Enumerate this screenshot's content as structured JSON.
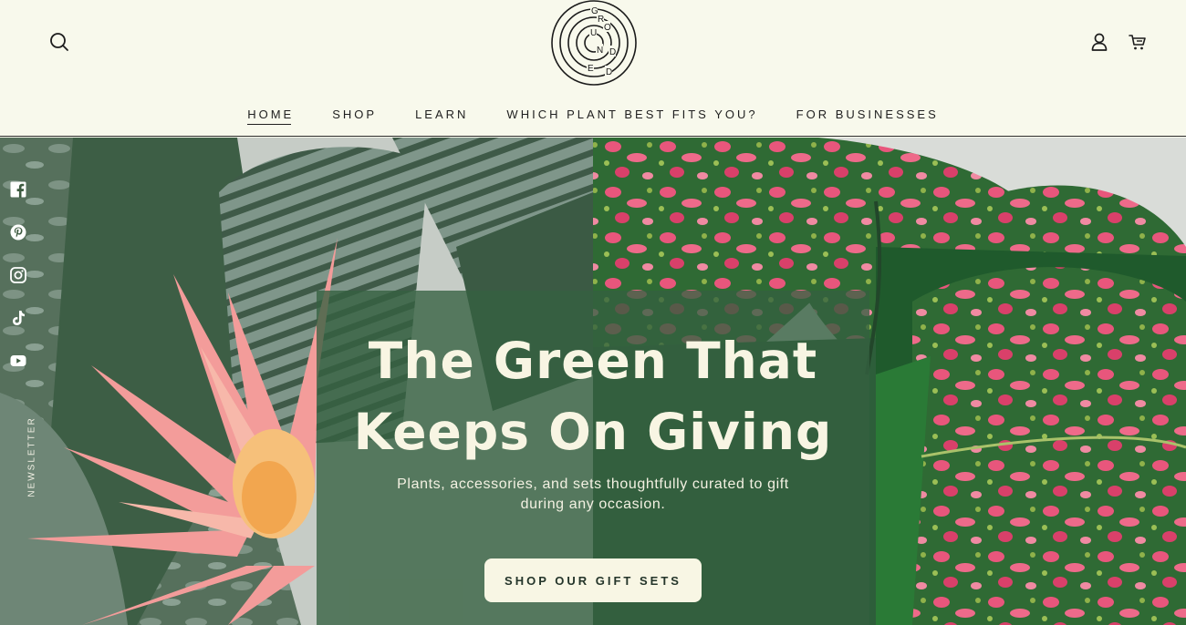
{
  "header": {
    "logo_letters": [
      "G",
      "R",
      "O",
      "U",
      "N",
      "D",
      "E",
      "D"
    ],
    "icons": {
      "search": "search-icon",
      "account": "user-icon",
      "cart": "cart-icon"
    }
  },
  "nav": {
    "items": [
      {
        "label": "HOME",
        "active": true
      },
      {
        "label": "SHOP",
        "active": false
      },
      {
        "label": "LEARN",
        "active": false
      },
      {
        "label": "WHICH PLANT BEST FITS YOU?",
        "active": false
      },
      {
        "label": "FOR BUSINESSES",
        "active": false
      }
    ]
  },
  "hero": {
    "title_line1": "The Green That",
    "title_line2": "Keeps On Giving",
    "subtitle_line1": "Plants, accessories, and sets thoughtfully curated to gift",
    "subtitle_line2": "during any occasion.",
    "cta_label": "SHOP OUR GIFT SETS"
  },
  "social": {
    "icons": [
      "facebook-icon",
      "pinterest-icon",
      "instagram-icon",
      "tiktok-icon",
      "youtube-icon"
    ],
    "newsletter_label": "NEWSLETTER"
  },
  "colors": {
    "background": "#f8f9ec",
    "panel": "#356040",
    "cta_bg": "#f8f6e4",
    "pink": "#e8567c",
    "leaf_dark": "#254b2c"
  }
}
